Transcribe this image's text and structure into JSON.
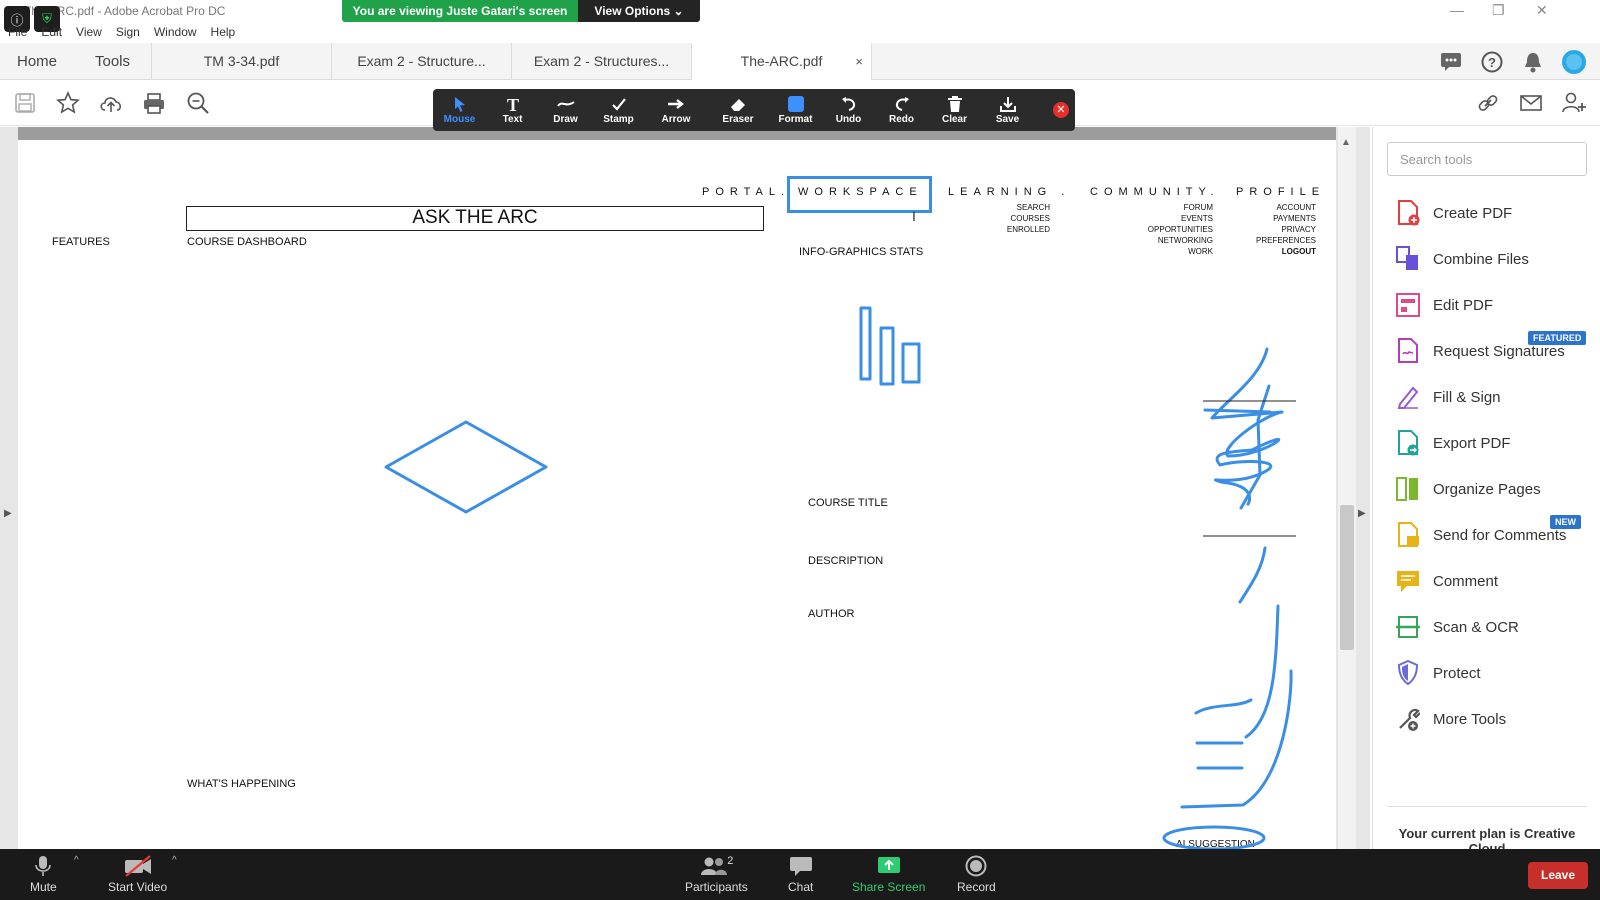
{
  "window": {
    "title": "The-ARC.pdf - Adobe Acrobat Pro DC",
    "minimize": "—",
    "restore": "❐",
    "close": "✕"
  },
  "zoom": {
    "banner": "You are viewing Juste Gatari's screen",
    "view_options": "View Options ⌄",
    "bottom": {
      "mute": "Mute",
      "start_video": "Start Video",
      "participants": "Participants",
      "participants_count": "2",
      "chat": "Chat",
      "share_screen": "Share Screen",
      "record": "Record",
      "leave": "Leave"
    }
  },
  "menu": [
    "File",
    "Edit",
    "View",
    "Sign",
    "Window",
    "Help"
  ],
  "tabs": {
    "home": "Home",
    "tools": "Tools",
    "docs": [
      "TM 3-34.pdf",
      "Exam 2  - Structure...",
      "Exam 2 - Structures...",
      "The-ARC.pdf"
    ],
    "close": "×"
  },
  "annotation_toolbar": [
    "Mouse",
    "Text",
    "Draw",
    "Stamp",
    "Arrow",
    "Eraser",
    "Format",
    "Undo",
    "Redo",
    "Clear",
    "Save"
  ],
  "sidebar": {
    "search_placeholder": "Search tools",
    "tools": [
      "Create PDF",
      "Combine Files",
      "Edit PDF",
      "Request Signatures",
      "Fill & Sign",
      "Export PDF",
      "Organize Pages",
      "Send for Comments",
      "Comment",
      "Scan & OCR",
      "Protect",
      "More Tools"
    ],
    "badges": {
      "featured": "FEATURED",
      "new": "NEW"
    },
    "plan": "Your current plan is Creative Cloud"
  },
  "pdf": {
    "nav": {
      "portal": "PORTAL.",
      "workspace": "WORKSPACE",
      "learning": "LEARNING .",
      "community": "COMMUNITY.",
      "profile": "PROFILE"
    },
    "learning_sub": [
      "SEARCH",
      "COURSES",
      "ENROLLED"
    ],
    "community_sub": [
      "FORUM",
      "EVENTS",
      "OPPORTUNITIES",
      "NETWORKING",
      "WORK"
    ],
    "profile_sub": [
      "ACCOUNT",
      "PAYMENTS",
      "PRIVACY",
      "PREFERENCES",
      "LOGOUT"
    ],
    "ask": "ASK THE ARC",
    "features": "FEATURES",
    "dashboard": "COURSE DASHBOARD",
    "infographics": "INFO-GRAPHICS STATS",
    "course_title": "COURSE TITLE",
    "description": "DESCRIPTION",
    "author": "AUTHOR",
    "whats_happening": "WHAT'S HAPPENING",
    "ai_suggestion": "AI SUGGESTION"
  },
  "colors": {
    "accent": "#2f80ed",
    "annotation_stroke": "#3a8ee6",
    "zoom_green": "#1fa24a",
    "leave_red": "#c7302a"
  }
}
